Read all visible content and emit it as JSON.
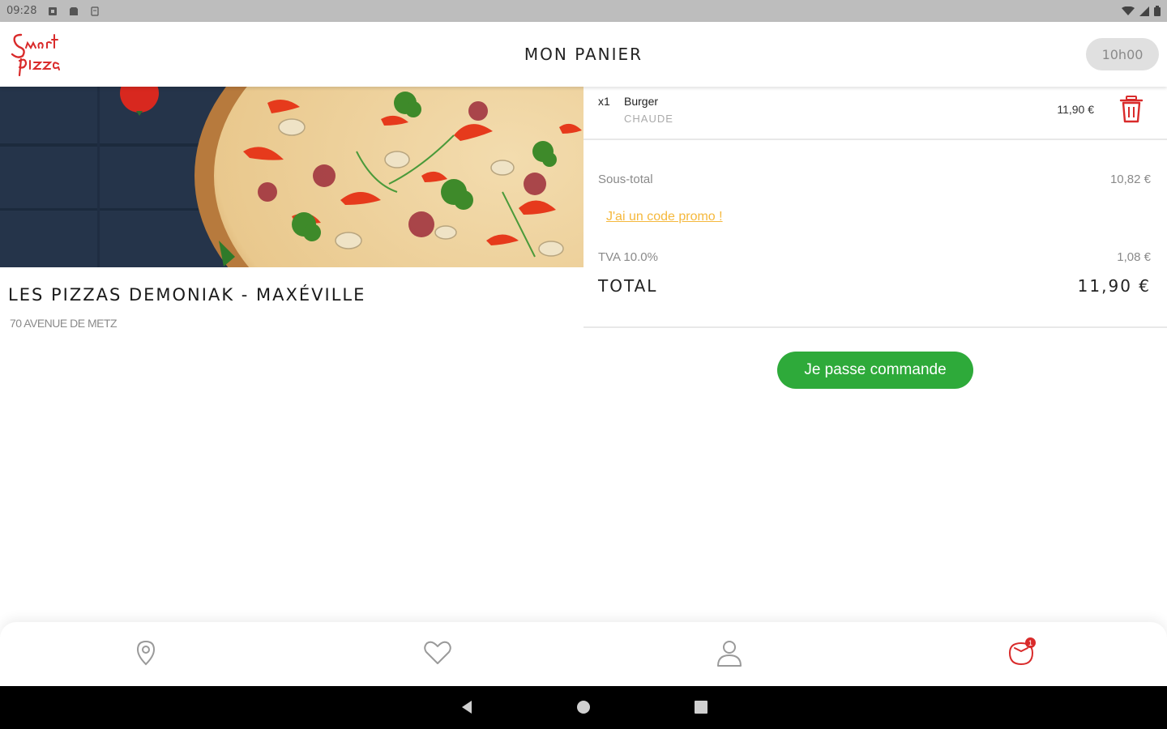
{
  "status_bar": {
    "time": "09:28"
  },
  "app_bar": {
    "title": "MON PANIER",
    "time_slot": "10h00",
    "logo_text": "Smart pizza"
  },
  "restaurant": {
    "name": "LES PIZZAS DEMONIAK - MAXÉVILLE",
    "address": "70 AVENUE DE METZ"
  },
  "cart": {
    "items": [
      {
        "qty": "x1",
        "name": "Burger",
        "option": "CHAUDE",
        "price": "11,90 €"
      }
    ],
    "subtotal_label": "Sous-total",
    "subtotal_value": "10,82 €",
    "promo_link": "J'ai un code promo !",
    "tva_label": "TVA 10.0%",
    "tva_value": "1,08 €",
    "total_label": "TOTAL",
    "total_value": "11,90 €",
    "order_button": "Je passe commande"
  },
  "bottom_nav": {
    "cart_badge": "1",
    "items": [
      "location-icon",
      "heart-icon",
      "profile-icon",
      "cart-icon"
    ]
  },
  "colors": {
    "brand_red": "#d92b2b",
    "accent_green": "#2eaa3a",
    "promo_orange": "#f5b83c",
    "muted": "#8a8a8a"
  }
}
